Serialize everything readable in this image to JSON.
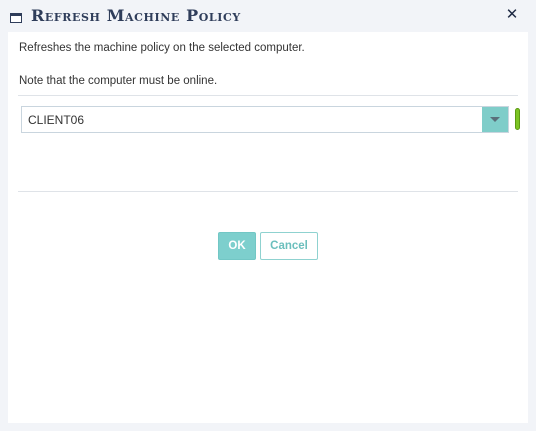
{
  "dialog": {
    "title": "Refresh Machine Policy",
    "window_icon": "window-icon",
    "close_icon": "close-icon",
    "close_glyph": "✕"
  },
  "content": {
    "description": "Refreshes the machine policy on the selected computer.",
    "note": "Note that the computer must be online."
  },
  "computer_select": {
    "selected_value": "CLIENT06",
    "arrow_icon": "chevron-down-icon",
    "status_color": "#7cc423",
    "status": "online"
  },
  "buttons": {
    "ok_label": "OK",
    "cancel_label": "Cancel"
  },
  "colors": {
    "accent": "#7dcfcd",
    "title": "#2f3d5a",
    "background": "#f2f4f8"
  }
}
